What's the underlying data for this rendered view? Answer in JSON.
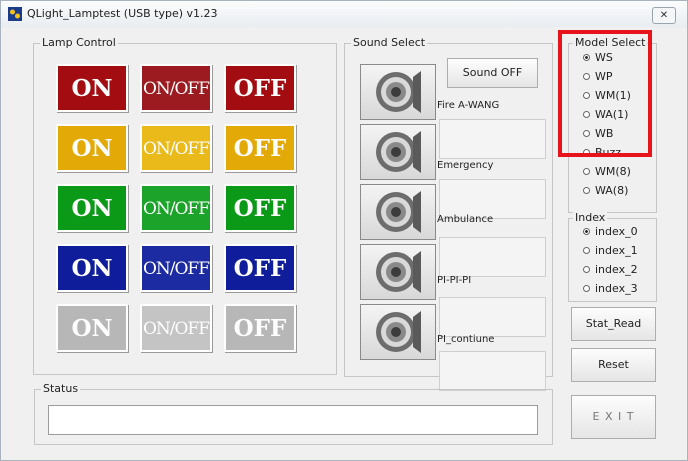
{
  "window": {
    "title": "QLight_Lamptest (USB type)  v1.23",
    "close_label": "✕"
  },
  "lamp_control": {
    "label": "Lamp Control",
    "rows": [
      {
        "color": "red",
        "on_bg": "#9f0d12",
        "on": "ON",
        "onoff": "ON/OFF",
        "off": "OFF"
      },
      {
        "color": "yellow",
        "on_bg": "#e3a906",
        "on": "ON",
        "onoff": "ON/OFF",
        "off": "OFF"
      },
      {
        "color": "green",
        "on_bg": "#0c9b17",
        "on": "ON",
        "onoff": "ON/OFF",
        "off": "OFF"
      },
      {
        "color": "blue",
        "on_bg": "#0f1c9c",
        "on": "ON",
        "onoff": "ON/OFF",
        "off": "OFF"
      },
      {
        "color": "white",
        "on_bg": "#b5b5b5",
        "on": "ON",
        "onoff": "ON/OFF",
        "off": "OFF"
      }
    ]
  },
  "sound_select": {
    "label": "Sound Select",
    "sound_off_label": "Sound OFF",
    "sounds": [
      "Fire A-WANG",
      "Emergency",
      "Ambulance",
      "PI-PI-PI",
      "PI_contiune"
    ]
  },
  "model_select": {
    "label": "Model Select",
    "options": [
      "WS",
      "WP",
      "WM(1)",
      "WA(1)",
      "WB",
      "Buzz",
      "WM(8)",
      "WA(8)"
    ],
    "selected": "WS"
  },
  "index": {
    "label": "Index",
    "options": [
      "index_0",
      "index_1",
      "index_2",
      "index_3"
    ],
    "selected": "index_0"
  },
  "buttons": {
    "stat_read": "Stat_Read",
    "reset": "Reset",
    "exit": "E X I T"
  },
  "status": {
    "label": "Status",
    "value": ""
  },
  "highlight_color": "#e8141b"
}
